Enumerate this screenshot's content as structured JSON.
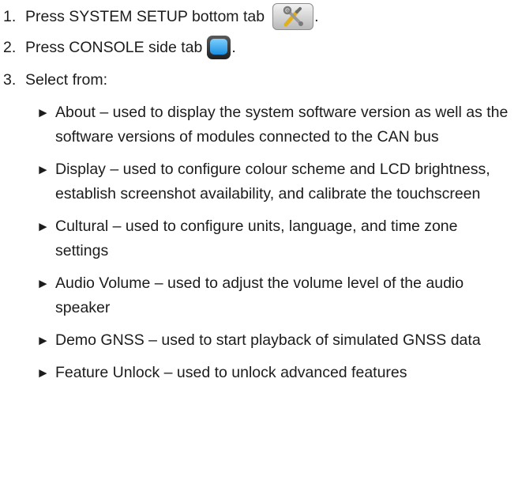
{
  "steps": [
    {
      "number": "1.",
      "text": "Press SYSTEM SETUP bottom tab",
      "icon": "system-setup-tools-icon",
      "suffix": "."
    },
    {
      "number": "2.",
      "text": "Press CONSOLE side tab",
      "icon": "console-tab-icon",
      "suffix": "."
    },
    {
      "number": "3.",
      "text": "Select from:"
    }
  ],
  "options": [
    {
      "text": "About – used to display the system software version as well as the software versions of modules connected to the CAN bus"
    },
    {
      "text": "Display – used to configure colour scheme and LCD brightness, establish screenshot availability, and calibrate the touchscreen"
    },
    {
      "text": "Cultural – used to configure units, language, and time zone settings"
    },
    {
      "text": "Audio Volume – used to adjust the volume level of the audio speaker"
    },
    {
      "text": "Demo GNSS – used to start playback of simulated GNSS data"
    },
    {
      "text": "Feature Unlock – used to unlock advanced features"
    }
  ],
  "bullet_glyph": "►"
}
